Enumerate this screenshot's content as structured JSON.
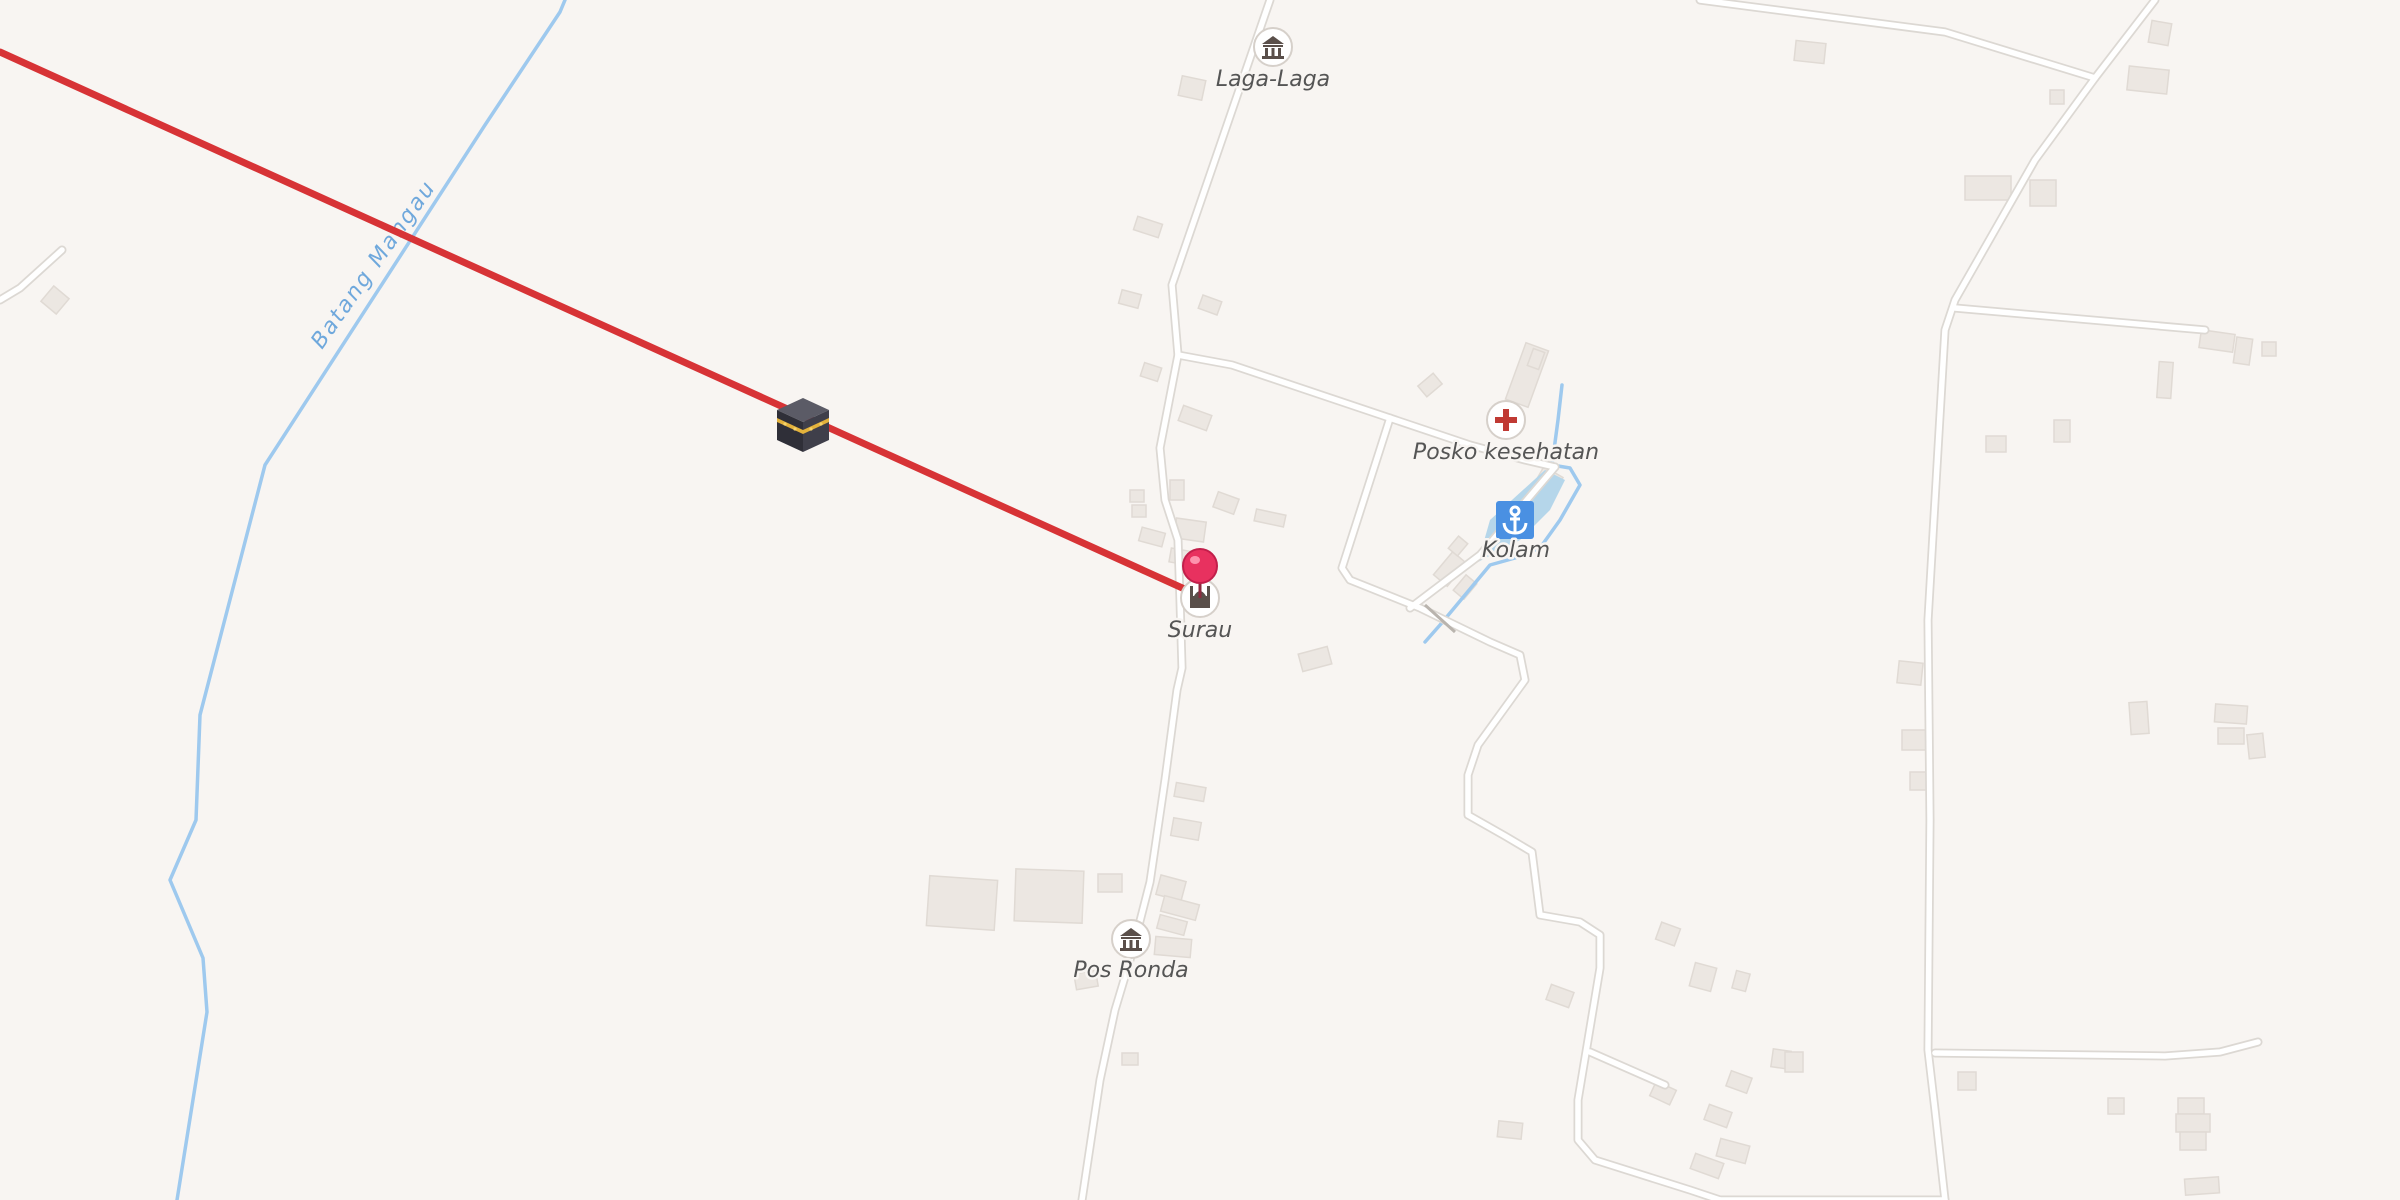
{
  "map": {
    "background": "#f8f5f2",
    "road_color": "#ffffff",
    "road_casing": "#dedad6",
    "water_color": "#9ec9ee",
    "building_color": "#ece7e2",
    "route_color": "#d73336"
  },
  "waterway": {
    "name": "Batang Mangau"
  },
  "pois": [
    {
      "id": "laga-laga",
      "label": "Laga-Laga",
      "icon": "museum-icon"
    },
    {
      "id": "posko-kesehatan",
      "label": "Posko kesehatan",
      "icon": "health-post-icon"
    },
    {
      "id": "kolam",
      "label": "Kolam",
      "icon": "anchor-icon"
    },
    {
      "id": "surau",
      "label": "Surau",
      "icon": "mosque-icon"
    },
    {
      "id": "pos-ronda",
      "label": "Pos Ronda",
      "icon": "museum-icon"
    }
  ],
  "markers": {
    "destination": {
      "icon": "kaaba-icon"
    },
    "current": {
      "icon": "location-pin-icon",
      "color": "#e8315f"
    }
  }
}
